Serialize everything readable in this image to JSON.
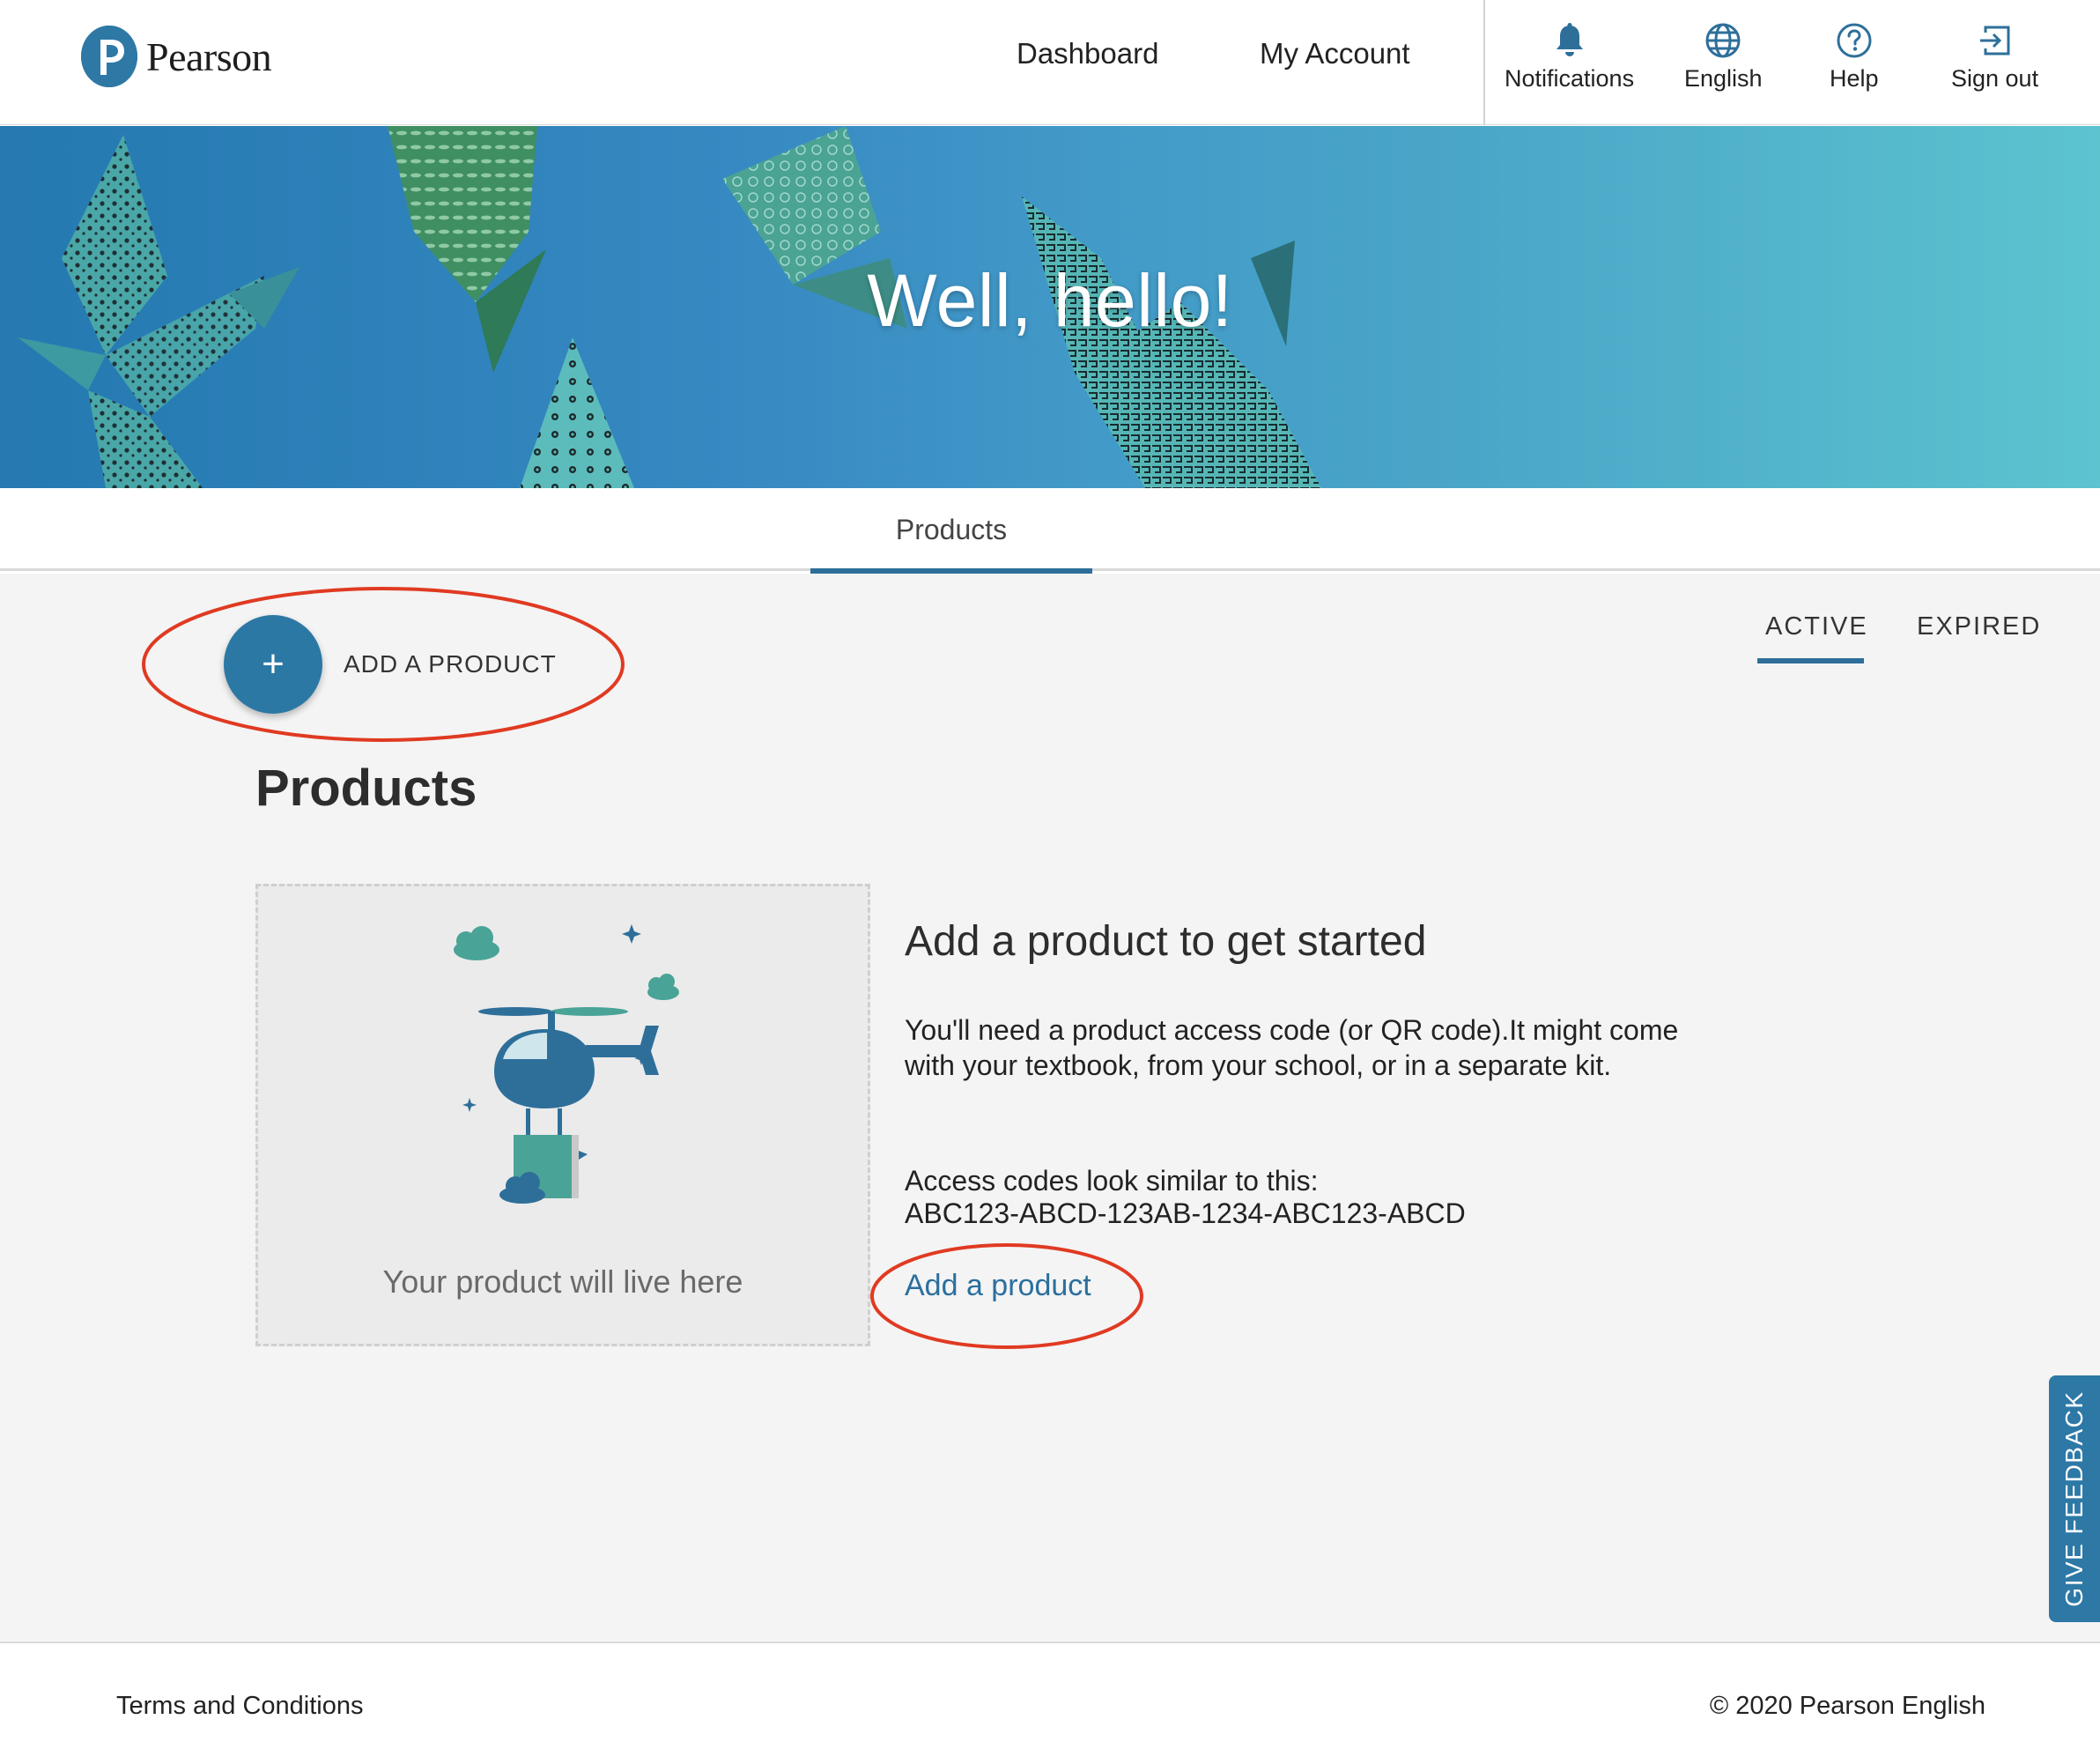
{
  "brand": {
    "name": "Pearson",
    "logo_letter": "P",
    "primary_color": "#2e78a6",
    "annotation_color": "#e03a22"
  },
  "header": {
    "nav": [
      {
        "label": "Dashboard"
      },
      {
        "label": "My Account"
      }
    ],
    "utilities": [
      {
        "label": "Notifications",
        "icon": "bell-icon"
      },
      {
        "label": "English",
        "icon": "globe-icon"
      },
      {
        "label": "Help",
        "icon": "question-circle-icon"
      },
      {
        "label": "Sign out",
        "icon": "sign-out-icon"
      }
    ]
  },
  "hero": {
    "title": "Well, hello!"
  },
  "tabs": {
    "active": "Products"
  },
  "main": {
    "add_button_label": "ADD A PRODUCT",
    "add_button_symbol": "+",
    "filters": [
      "ACTIVE",
      "EXPIRED"
    ],
    "heading": "Products",
    "placeholder_text": "Your product will live here",
    "info": {
      "title": "Add a product to get started",
      "paragraph": "You'll need a product access code (or QR code).It might come with your textbook, from your school, or in a separate kit.",
      "codes_intro": "Access codes look similar to this:",
      "code_example": "ABC123-ABCD-123AB-1234-ABC123-ABCD",
      "link_label": "Add a product"
    },
    "feedback_label": "GIVE FEEDBACK"
  },
  "footer": {
    "terms": "Terms and Conditions",
    "copyright": "© 2020 Pearson English"
  }
}
